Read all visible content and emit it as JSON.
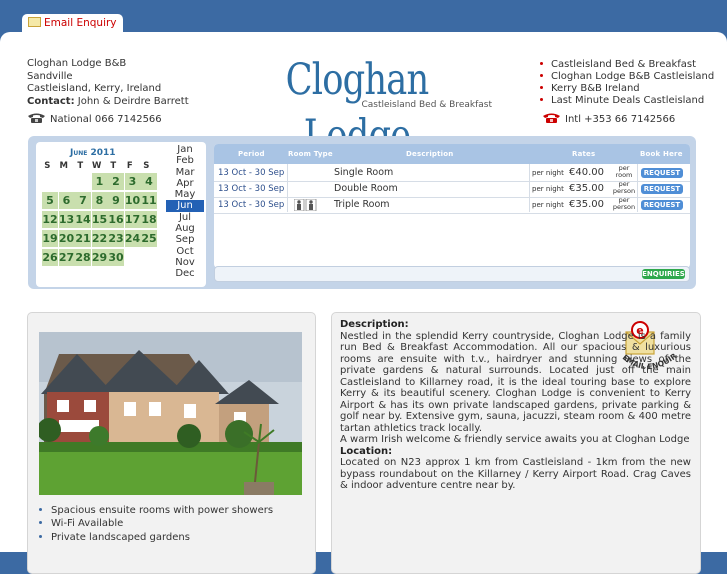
{
  "top_tab": {
    "label": "Email Enquiry",
    "icon": "envelope-icon"
  },
  "address": {
    "line1": "Cloghan Lodge B&B",
    "line2": "Sandville",
    "line3": "Castleisland, Kerry, Ireland",
    "contact_label": "Contact:",
    "contact_value": "John & Deirdre Barrett",
    "phone": "National 066 7142566"
  },
  "logo": {
    "title": "Cloghan Lodge",
    "subtitle": "Castleisland Bed & Breakfast"
  },
  "links": [
    "Castleisland Bed & Breakfast",
    "Cloghan Lodge B&B Castleisland",
    "Kerry B&B Ireland",
    "Last Minute Deals Castleisland"
  ],
  "phone_intl": "Intl +353 66 7142566",
  "calendar": {
    "title": "June 2011",
    "weekdays": [
      "S",
      "M",
      "T",
      "W",
      "T",
      "F",
      "S"
    ],
    "days": [
      "1",
      "2",
      "3",
      "4",
      "5",
      "6",
      "7",
      "8",
      "9",
      "10",
      "11",
      "12",
      "13",
      "14",
      "15",
      "16",
      "17",
      "18",
      "19",
      "20",
      "21",
      "22",
      "23",
      "24",
      "25",
      "26",
      "27",
      "28",
      "29",
      "30"
    ],
    "months": [
      "Jan",
      "Feb",
      "Mar",
      "Apr",
      "May",
      "Jun",
      "Jul",
      "Aug",
      "Sep",
      "Oct",
      "Nov",
      "Dec"
    ],
    "selected_month": "Jun"
  },
  "rooms_table": {
    "headers": {
      "period": "Period",
      "room_type": "Room Type",
      "description": "Description",
      "rates": "Rates",
      "book": "Book Here"
    },
    "rows": [
      {
        "period": "13 Oct - 30 Sep",
        "type": "Single Room",
        "per": "per night",
        "price": "€40.00",
        "unit": "per room",
        "button": "REQUEST"
      },
      {
        "period": "13 Oct - 30 Sep",
        "type": "Double Room",
        "per": "per night",
        "price": "€35.00",
        "unit": "per person",
        "button": "REQUEST"
      },
      {
        "period": "13 Oct - 30 Sep",
        "type": "Triple Room",
        "per": "per night",
        "price": "€35.00",
        "unit": "per person",
        "button": "REQUEST"
      }
    ],
    "enquiries_button": "ENQUIRIES"
  },
  "features": [
    "Spacious ensuite rooms with power showers",
    "Wi-Fi Available",
    "Private landscaped gardens"
  ],
  "description": {
    "heading": "Description:",
    "body": "Nestled in the splendid Kerry countryside, Cloghan Lodge is a family run Bed & Breakfast Accommodation. All our spacious & luxurious rooms are ensuite with t.v., hairdryer and stunning views of the private gardens & natural surrounds. Located just off the main Castleisland to Killarney road, it is the ideal touring base to explore Kerry & its beautiful scenery. Cloghan Lodge is convenient to Kerry Airport & has its own private landscaped gardens, private parking & golf near by. Extensive gym, sauna, jacuzzi, steam room & 400 metre tartan athletics track locally.",
    "welcome": "A warm Irish welcome & friendly service awaits you at Cloghan Lodge",
    "location_heading": "Location:",
    "location_body": "Located on N23 approx 1 km from Castleisland - 1km from the new bypass roundabout on the Killarney / Kerry Airport Road. Crag Caves & indoor adventure centre near by.",
    "stamp_text": "EMAIL ENQUIRIES"
  },
  "colors": {
    "brand_blue": "#3c6aa3",
    "logo_blue": "#2d6ea3",
    "calendar_green": "#c9dfae",
    "request_blue": "#4f8ed6",
    "enquiries_green": "#2ea84c"
  }
}
